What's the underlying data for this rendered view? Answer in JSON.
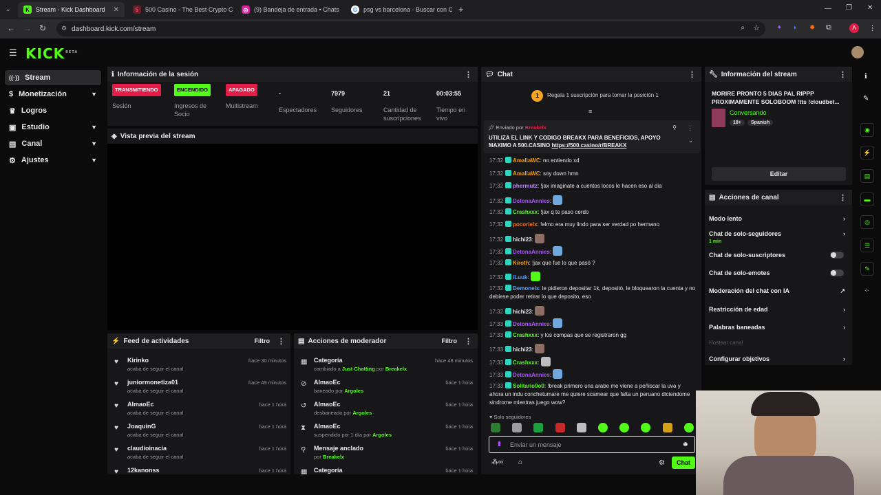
{
  "browser": {
    "tabs": [
      {
        "title": "Stream - Kick Dashboard",
        "active": true
      },
      {
        "title": "500 Casino - The Best Crypto C",
        "active": false
      },
      {
        "title": "(9) Bandeja de entrada • Chats",
        "active": false
      },
      {
        "title": "psg vs barcelona - Buscar con G",
        "active": false
      }
    ],
    "url": "dashboard.kick.com/stream"
  },
  "site": {
    "logo": "KICK",
    "logo_badge": "BETA"
  },
  "sidebar": {
    "items": [
      {
        "label": "Stream",
        "icon": "broadcast-icon",
        "active": true,
        "chevron": false
      },
      {
        "label": "Monetización",
        "icon": "dollar-icon",
        "active": false,
        "chevron": true
      },
      {
        "label": "Logros",
        "icon": "trophy-icon",
        "active": false,
        "chevron": false
      },
      {
        "label": "Estudio",
        "icon": "studio-icon",
        "active": false,
        "chevron": true
      },
      {
        "label": "Canal",
        "icon": "channel-icon",
        "active": false,
        "chevron": true
      },
      {
        "label": "Ajustes",
        "icon": "gear-icon",
        "active": false,
        "chevron": true
      }
    ]
  },
  "session": {
    "title": "Información de la sesión",
    "stats": [
      {
        "badge": "TRANSMITIENDO",
        "label": "Sesión",
        "color": "#e11d48"
      },
      {
        "badge": "ENCENDIDO",
        "label": "Ingresos de Socio",
        "color": "#53fc18"
      },
      {
        "badge": "APAGADO",
        "label": "Multistream",
        "color": "#e11d48"
      },
      {
        "value": "-",
        "label": "Espectadores"
      },
      {
        "value": "7979",
        "label": "Seguidores"
      },
      {
        "value": "21",
        "label": "Cantidad de suscripciones"
      },
      {
        "value": "00:03:55",
        "label": "Tiempo en vivo"
      }
    ]
  },
  "preview": {
    "title": "Vista previa del stream"
  },
  "feed": {
    "title": "Feed de actividades",
    "filter": "Filtro",
    "rows": [
      {
        "name": "Kirinko",
        "sub": "acaba de seguir el canal",
        "time": "hace 30 minutos"
      },
      {
        "name": "juniormonetiza01",
        "sub": "acaba de seguir el canal",
        "time": "hace 49 minutos"
      },
      {
        "name": "AlmaoEc",
        "sub": "acaba de seguir el canal",
        "time": "hace 1 hora"
      },
      {
        "name": "JoaquinG",
        "sub": "acaba de seguir el canal",
        "time": "hace 1 hora"
      },
      {
        "name": "claudioinacia",
        "sub": "acaba de seguir el canal",
        "time": "hace 1 hora"
      },
      {
        "name": "12kanonss",
        "sub": "",
        "time": "hace 1 hora"
      }
    ]
  },
  "mod": {
    "title": "Acciones de moderador",
    "filter": "Filtro",
    "rows": [
      {
        "name": "Categoría",
        "pre": "cambiado a",
        "hl": "Just Chatting",
        "mid": "por",
        "user": "Breakelx",
        "time": "hace 48 minutos",
        "icon": "calendar-icon"
      },
      {
        "name": "AlmaoEc",
        "pre": "baneado por",
        "hl": "",
        "mid": "",
        "user": "Argoles",
        "time": "hace 1 hora",
        "icon": "ban-icon"
      },
      {
        "name": "AlmaoEc",
        "pre": "desbaneado por",
        "hl": "",
        "mid": "",
        "user": "Argoles",
        "time": "hace 1 hora",
        "icon": "undo-icon"
      },
      {
        "name": "AlmaoEc",
        "pre": "suspendido por 1 día por",
        "hl": "",
        "mid": "",
        "user": "Argoles",
        "time": "hace 1 hora",
        "icon": "hourglass-icon"
      },
      {
        "name": "Mensaje anclado",
        "pre": "por",
        "hl": "",
        "mid": "",
        "user": "Breakelx",
        "time": "hace 1 hora",
        "icon": "pin-icon"
      },
      {
        "name": "Categoría",
        "pre": "",
        "hl": "",
        "mid": "",
        "user": "",
        "time": "hace 1 hora",
        "icon": "calendar-icon"
      }
    ]
  },
  "chat": {
    "title": "Chat",
    "gift_rank": "1",
    "gift_text": "Regala 1 suscripción para tomar la posición 1",
    "pinned_by": "Enviado por",
    "pinned_user": "Breakelx",
    "pinned_text": "UTILIZA EL LINK Y CODIGO BREAKX PARA BENEFICIOS, APOYO MAXIMO A 500.CASINO",
    "pinned_link": "https://500.casino/r/BREAKX",
    "messages": [
      {
        "time": "17:32",
        "user": "AmaliaWC",
        "color": "#f59e0b",
        "text": "no entiendo xd"
      },
      {
        "time": "17:32",
        "user": "AmaliaWC",
        "color": "#f59e0b",
        "text": "soy down hmn"
      },
      {
        "time": "17:32",
        "user": "phermutz",
        "color": "#c084fc",
        "text": "!jax imaginate a cuentos locos le hacen eso al dia"
      },
      {
        "time": "17:32",
        "user": "DetonaAnnies",
        "color": "#a855f7",
        "text": ""
      },
      {
        "time": "17:32",
        "user": "Crashxxx",
        "color": "#53fc18",
        "text": "!jax q te paso cerdo"
      },
      {
        "time": "17:32",
        "user": "pocorielx",
        "color": "#f97316",
        "text": "!elmo era muy lindo para ser verdad po hermano"
      },
      {
        "time": "17:32",
        "user": "hichi23",
        "color": "#e5e7eb",
        "text": ""
      },
      {
        "time": "17:32",
        "user": "DetonaAnnies",
        "color": "#a855f7",
        "text": ""
      },
      {
        "time": "17:32",
        "user": "Kiroth",
        "color": "#f59e0b",
        "text": "!jax que fue lo que pasó ?"
      },
      {
        "time": "17:32",
        "user": "iLuuk",
        "color": "#60a5fa",
        "text": ""
      },
      {
        "time": "17:32",
        "user": "Demonelx",
        "color": "#60a5fa",
        "text": "le pidieron depositar 1k, depositó, le bloquearon la cuenta y no debiese poder retirar lo que deposito, eso"
      },
      {
        "time": "17:32",
        "user": "hichi23",
        "color": "#e5e7eb",
        "text": ""
      },
      {
        "time": "17:33",
        "user": "DetonaAnnies",
        "color": "#a855f7",
        "text": ""
      },
      {
        "time": "17:33",
        "user": "Crashxxx",
        "color": "#53fc18",
        "text": "y los compas que se registraron gg"
      },
      {
        "time": "17:33",
        "user": "hichi23",
        "color": "#e5e7eb",
        "text": ""
      },
      {
        "time": "17:33",
        "user": "Crashxxx",
        "color": "#53fc18",
        "text": ""
      },
      {
        "time": "17:33",
        "user": "DetonaAnnies",
        "color": "#a855f7",
        "text": ""
      },
      {
        "time": "17:33",
        "user": "Solitario0o0",
        "color": "#53fc18",
        "text": "!break primero una arabe me viene a peñiscar la uva y ahora un indu conchetumare me quiere scamear que falta un peruano diciendome sindrome mientras juego wow?"
      }
    ],
    "mode": "Solo seguidores",
    "placeholder": "Enviar un mensaje",
    "send": "Chat"
  },
  "stream_info": {
    "title": "Información del stream",
    "stream_title": "MORIRE PRONTO 5 DIAS PAL RIPPP PROXIMAMENTE SOLOBOOM !tts !cloudbet...",
    "category": "Conversando",
    "tags": [
      "18+",
      "Spanish"
    ],
    "edit": "Editar"
  },
  "channel_actions": {
    "title": "Acciones de canal",
    "items": [
      {
        "label": "Modo lento",
        "kind": "chevron",
        "sub": ""
      },
      {
        "label": "Chat de solo-seguidores",
        "kind": "chevron",
        "sub": "1 min"
      },
      {
        "label": "Chat de solo-suscriptores",
        "kind": "toggle",
        "sub": ""
      },
      {
        "label": "Chat de solo-emotes",
        "kind": "toggle",
        "sub": ""
      },
      {
        "label": "Moderación del chat con IA",
        "kind": "external",
        "sub": ""
      },
      {
        "label": "Restricción de edad",
        "kind": "chevron",
        "sub": ""
      },
      {
        "label": "Palabras baneadas",
        "kind": "chevron",
        "sub": ""
      },
      {
        "label": "Hostear canal",
        "kind": "disabled",
        "sub": ""
      },
      {
        "label": "Configurar objetivos",
        "kind": "chevron",
        "sub": ""
      }
    ]
  }
}
